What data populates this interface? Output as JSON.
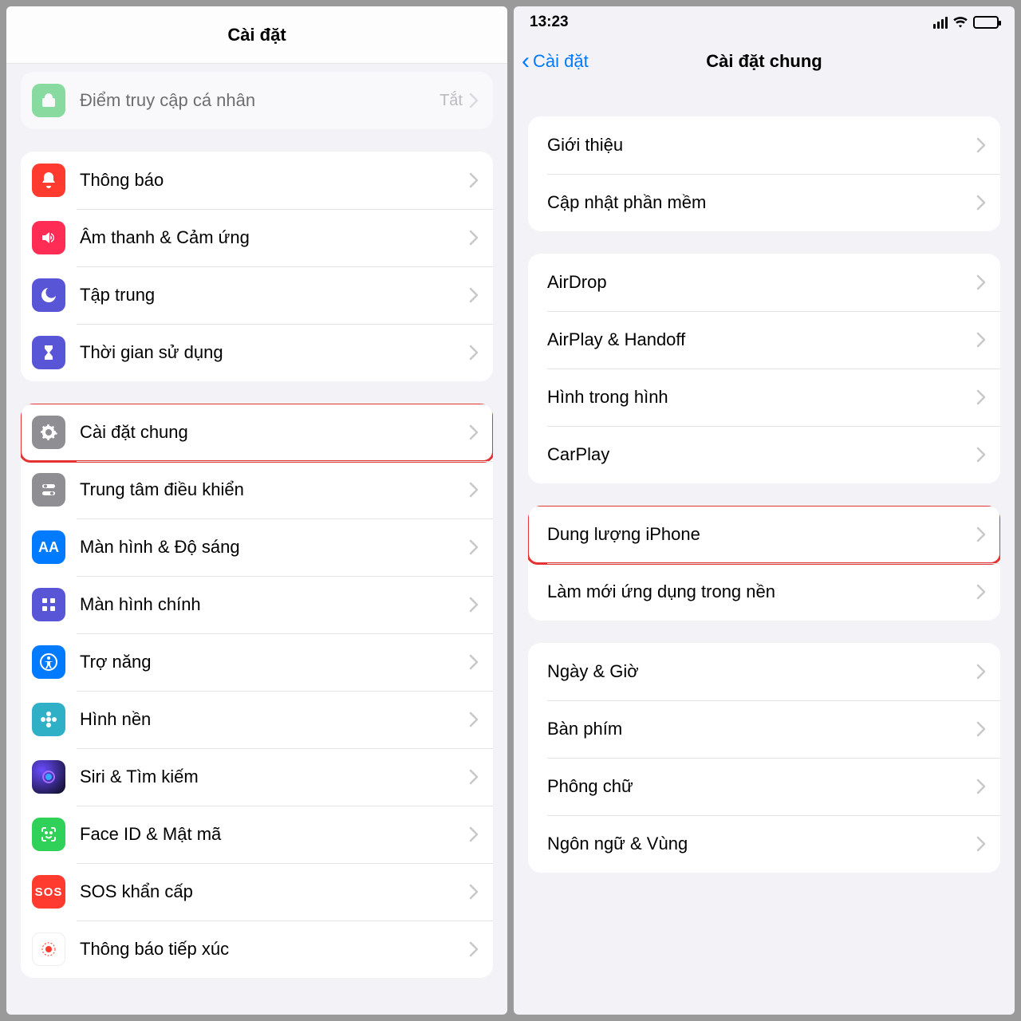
{
  "left": {
    "title": "Cài đặt",
    "faded_row": {
      "label": "Điểm truy cập cá nhân",
      "detail": "Tắt"
    },
    "group_notif": [
      {
        "id": "notifications",
        "label": "Thông báo",
        "iconColor": "bg-red"
      },
      {
        "id": "sounds",
        "label": "Âm thanh & Cảm ứng",
        "iconColor": "bg-pink"
      },
      {
        "id": "focus",
        "label": "Tập trung",
        "iconColor": "bg-indigo"
      },
      {
        "id": "screentime",
        "label": "Thời gian sử dụng",
        "iconColor": "bg-indigo"
      }
    ],
    "group_general": [
      {
        "id": "general",
        "label": "Cài đặt chung",
        "iconColor": "bg-gray",
        "highlight": true
      },
      {
        "id": "controlcenter",
        "label": "Trung tâm điều khiển",
        "iconColor": "bg-gray"
      },
      {
        "id": "display",
        "label": "Màn hình & Độ sáng",
        "iconColor": "bg-blue"
      },
      {
        "id": "homescreen",
        "label": "Màn hình chính",
        "iconColor": "bg-indigo"
      },
      {
        "id": "accessibility",
        "label": "Trợ năng",
        "iconColor": "bg-blue"
      },
      {
        "id": "wallpaper",
        "label": "Hình nền",
        "iconColor": "bg-teal"
      },
      {
        "id": "siri",
        "label": "Siri & Tìm kiếm",
        "iconColor": "bg-darkgrad"
      },
      {
        "id": "faceid",
        "label": "Face ID & Mật mã",
        "iconColor": "bg-green2"
      },
      {
        "id": "sos",
        "label": "SOS khẩn cấp",
        "iconColor": "bg-sos"
      },
      {
        "id": "exposure",
        "label": "Thông báo tiếp xúc",
        "iconColor": "bg-white"
      }
    ]
  },
  "right": {
    "time": "13:23",
    "back": "Cài đặt",
    "title": "Cài đặt chung",
    "group1": [
      {
        "id": "about",
        "label": "Giới thiệu"
      },
      {
        "id": "update",
        "label": "Cập nhật phần mềm"
      }
    ],
    "group2": [
      {
        "id": "airdrop",
        "label": "AirDrop"
      },
      {
        "id": "airplay",
        "label": "AirPlay & Handoff"
      },
      {
        "id": "pip",
        "label": "Hình trong hình"
      },
      {
        "id": "carplay",
        "label": "CarPlay"
      }
    ],
    "group3": [
      {
        "id": "storage",
        "label": "Dung lượng iPhone",
        "highlight": true
      },
      {
        "id": "bgapp",
        "label": "Làm mới ứng dụng trong nền"
      }
    ],
    "group4": [
      {
        "id": "datetime",
        "label": "Ngày & Giờ"
      },
      {
        "id": "keyboard",
        "label": "Bàn phím"
      },
      {
        "id": "fonts",
        "label": "Phông chữ"
      },
      {
        "id": "lang",
        "label": "Ngôn ngữ & Vùng"
      }
    ]
  }
}
